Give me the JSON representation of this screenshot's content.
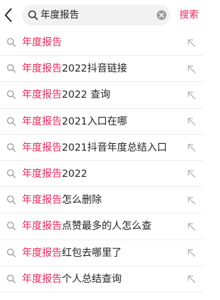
{
  "search": {
    "query": "年度报告",
    "submit_label": "搜索"
  },
  "suggestions": [
    {
      "highlight": "年度报告",
      "rest": ""
    },
    {
      "highlight": "年度报告",
      "rest": "2022抖音链接"
    },
    {
      "highlight": "年度报告",
      "rest": "2022 查询"
    },
    {
      "highlight": "年度报告",
      "rest": "2021入口在哪"
    },
    {
      "highlight": "年度报告",
      "rest": "2021抖音年度总结入口"
    },
    {
      "highlight": "年度报告",
      "rest": "2022"
    },
    {
      "highlight": "年度报告",
      "rest": "怎么删除"
    },
    {
      "highlight": "年度报告",
      "rest": "点赞最多的人怎么查"
    },
    {
      "highlight": "年度报告",
      "rest": "红包去哪里了"
    },
    {
      "highlight": "年度报告",
      "rest": "个人总结查询"
    }
  ],
  "icons": {
    "back": "chevron-left-icon",
    "search": "search-icon",
    "clear": "clear-icon",
    "fill": "arrow-up-left-icon"
  },
  "colors": {
    "accent": "#e8285b",
    "text": "#222222",
    "icon": "#9a9a9a",
    "search_bg": "#f2f2f2"
  }
}
